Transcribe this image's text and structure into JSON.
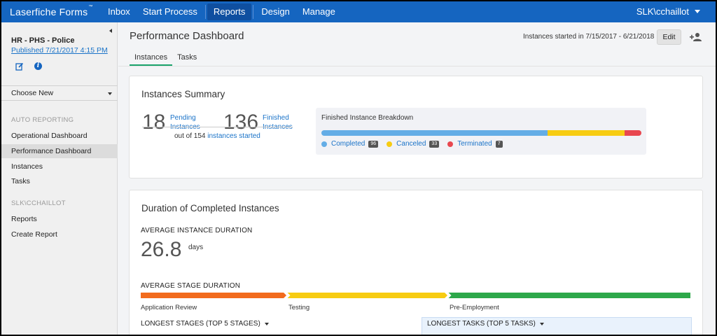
{
  "nav": {
    "brand": "Laserfiche Forms",
    "brand_mark": "™",
    "items": [
      "Inbox",
      "Start Process",
      "Reports",
      "Design",
      "Manage"
    ],
    "active": "Reports",
    "user": "SLK\\cchaillot"
  },
  "sidebar": {
    "process_name": "HR - PHS - Police",
    "published": "Published 7/21/2017 4:15 PM",
    "choose_new": "Choose New",
    "sections": [
      {
        "title": "AUTO REPORTING",
        "items": [
          "Operational Dashboard",
          "Performance Dashboard",
          "Instances",
          "Tasks"
        ]
      },
      {
        "title": "SLK\\CCHAILLOT",
        "items": [
          "Reports",
          "Create Report"
        ]
      }
    ],
    "active_item": "Performance Dashboard"
  },
  "header": {
    "title": "Performance Dashboard",
    "tabs": [
      "Instances",
      "Tasks"
    ],
    "active_tab": "Instances",
    "range": "Instances started in 7/15/2017 - 6/21/2018",
    "edit_label": "Edit"
  },
  "summary": {
    "title": "Instances Summary",
    "pending_count": "18",
    "pending_label_1": "Pending",
    "pending_label_2": "Instances",
    "finished_count": "136",
    "finished_label_1": "Finished",
    "finished_label_2": "Instances",
    "out_of_prefix": "out of 154",
    "out_of_link": "instances started",
    "breakdown_title": "Finished Instance Breakdown",
    "breakdown": [
      {
        "label": "Completed",
        "count": "96",
        "value": 96,
        "color": "#64ade6"
      },
      {
        "label": "Canceled",
        "count": "33",
        "value": 33,
        "color": "#f7cc12"
      },
      {
        "label": "Terminated",
        "count": "7",
        "value": 7,
        "color": "#e8474f"
      }
    ]
  },
  "duration": {
    "title": "Duration of Completed Instances",
    "avg_instance_label": "AVERAGE INSTANCE DURATION",
    "avg_value": "26.8",
    "avg_unit": "days",
    "avg_stage_label": "AVERAGE STAGE DURATION",
    "stages": [
      {
        "label": "Application Review",
        "color": "#f26b1d",
        "share": 0.265
      },
      {
        "label": "Testing",
        "color": "#f7cc12",
        "share": 0.293
      },
      {
        "label": "Pre-Employment",
        "color": "#2da84a",
        "share": 0.442
      }
    ],
    "longest_stages": "LONGEST STAGES (TOP 5 STAGES)",
    "longest_tasks": "LONGEST TASKS (TOP 5 TASKS)"
  }
}
